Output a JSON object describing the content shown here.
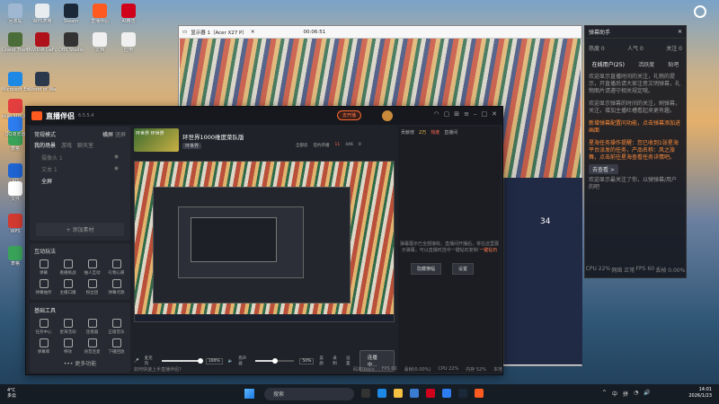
{
  "desktop": {
    "icons": [
      {
        "label": "回收站",
        "color": "#9fb7d1"
      },
      {
        "label": "WPS表格",
        "color": "#e9ecef"
      },
      {
        "label": "Steam",
        "color": "#1b2838"
      },
      {
        "label": "直播伴侣",
        "color": "#ff5a1f"
      },
      {
        "label": "AI精选",
        "color": "#d0021b"
      },
      {
        "label": "Grand Theft Auto V",
        "color": "#4b6d3a"
      },
      {
        "label": "NVIDIA GeForce",
        "color": "#b0121b"
      },
      {
        "label": "OBS Studio",
        "color": "#333"
      },
      {
        "label": "文档",
        "color": "#f0f0f0"
      },
      {
        "label": "应用",
        "color": "#f0f0f0"
      },
      {
        "label": "Microsoft Edge",
        "color": "#1e88e5"
      },
      {
        "label": "World of Warships",
        "color": "#2a3a4c"
      },
      {
        "label": "网易UU加速器",
        "color": "#e43f3f"
      },
      {
        "label": "表格",
        "color": "#3aa35a"
      },
      {
        "label": "XO",
        "color": "#1e64d2"
      },
      {
        "label": "QQ浏览器",
        "color": "#2d7cf0"
      },
      {
        "label": "微信",
        "color": "#2aae67"
      },
      {
        "label": "文件",
        "color": "#ffffff"
      },
      {
        "label": "WPS",
        "color": "#d23a30"
      },
      {
        "label": "表格",
        "color": "#3aa35a"
      }
    ]
  },
  "mirror_window": {
    "title": "显示器 1（Acer X27 P）",
    "timer": "00:06:51"
  },
  "assistant": {
    "title": "弹幕助手",
    "stats": [
      "热度 0",
      "人气 0",
      "关注 0"
    ],
    "tabs": [
      "在线用户(25)",
      "活跃度",
      "贴吧"
    ],
    "messages": [
      "欢迎显示直播时间的关注，礼物的提示，开直播后请大家注意文明弹幕，礼物图片请遵守相关规定哦。",
      "欢迎显示弹幕的时间的关注，刷弹幕，关注，增加主播吐槽看起来更有趣。",
      "新增弹幕配置问功能，点击弹幕添加进画面",
      "星海任务操作提醒：您已收到1张星海平台派发的任务，产品名称：风之旅舞，点击前往星海查看任务详情吧。",
      "欢迎显示最关注了你，以弹弹幕/用户的吧"
    ],
    "highlight_btn": "去查看 >",
    "footer": [
      "CPU 22%",
      "网络 正常",
      "FPS 60",
      "丢帧 0.00%"
    ]
  },
  "app": {
    "name": "直播伴侣",
    "version": "6.5.5.4",
    "live_btn": "去开播",
    "badge": "New",
    "sidebar": {
      "mode": "常规模式",
      "landscape": "横屏",
      "portrait": "竖屏",
      "scene_tabs": [
        "我的场景",
        "游戏",
        "聊天室"
      ],
      "sources": [
        {
          "name": "摄像头 1",
          "active": false
        },
        {
          "name": "文本 1",
          "active": false
        },
        {
          "name": "全屏",
          "active": true
        }
      ],
      "add_source": "+ 添加素材",
      "interact_title": "互动玩法",
      "interact_tools": [
        "弹幕",
        "看播挑战",
        "抽人互动",
        "礼物心愿",
        "弹幕抽奖",
        "主播口播",
        "粉丝团",
        "弹幕点歌"
      ],
      "basic_title": "基础工具",
      "basic_tools": [
        "任务中心",
        "星海活动",
        "连接器",
        "正版音乐",
        "弹幕库",
        "特效",
        "语音连麦",
        "下播回放"
      ],
      "more": "••• 更多功能"
    },
    "room": {
      "title": "环世界1000维度菜队版",
      "category": "环世界",
      "thumb_text": "环世界 环世界",
      "info": [
        "全部房",
        "签约开播",
        "11",
        "446",
        "0"
      ]
    },
    "preview_overlay": {
      "mic_label": "麦克风",
      "mic_value": "100%",
      "speaker_label": "扬声器",
      "speaker_value": "50%",
      "tools": [
        "美颜",
        "录制",
        "设置"
      ],
      "start_btn": "连播中..."
    },
    "chat": {
      "tabs": [
        "贡献榜",
        "直播间"
      ],
      "coins": "2万",
      "hot": "热度",
      "empty_text": "弹幕展示已全部接收，直播间开播后，将在这里展示弹幕，可以直播时选中一键钻石复制",
      "link_text": "一键钻石",
      "buttons": [
        "隐藏横幅",
        "设置"
      ]
    },
    "statusbar": {
      "warning": "如何快速上手直播伴侣?",
      "items": [
        "码率0kb/s",
        "FPS 60",
        "丢帧(0.00%)",
        "CPU 22%",
        "内存 52%",
        "本地"
      ]
    }
  },
  "steam_widget": {
    "temp": "34"
  },
  "taskbar": {
    "weather": "4°C",
    "weather_desc": "多云",
    "search": "搜索",
    "tray": [
      "^",
      "中",
      "拼"
    ],
    "time": "14:01",
    "date": "2026/1/23"
  }
}
